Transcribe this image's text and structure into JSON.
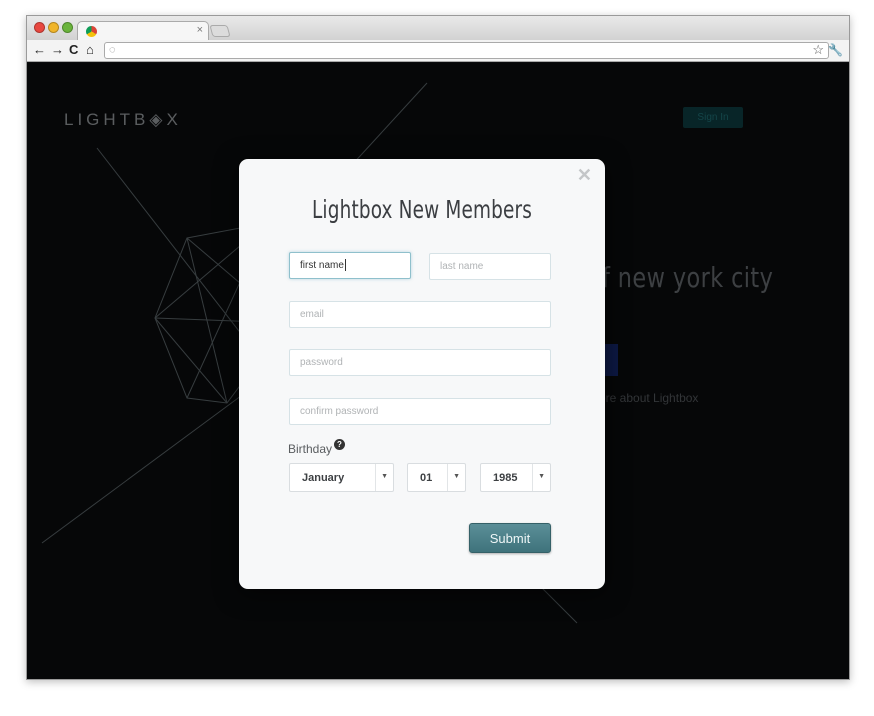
{
  "browser": {
    "tab": {
      "close": "×"
    },
    "nav": {
      "back": "←",
      "forward": "→",
      "reload": "C",
      "home": "⌂"
    }
  },
  "site": {
    "logo": "LIGHTB◈X",
    "signin_label": "Sign In",
    "hero_text": "f new york city",
    "learn_more": "ore about Lightbox"
  },
  "modal": {
    "close": "✕",
    "title": "Lightbox New Members",
    "fields": {
      "first_name": {
        "value": "first name",
        "focused": true
      },
      "last_name": {
        "placeholder": "last name"
      },
      "email": {
        "placeholder": "email"
      },
      "password": {
        "placeholder": "password"
      },
      "confirm_password": {
        "placeholder": "confirm password"
      }
    },
    "birthday_label": "Birthday",
    "help_icon": "?",
    "birthday": {
      "month": "January",
      "day": "01",
      "year": "1985"
    },
    "submit_label": "Submit"
  }
}
